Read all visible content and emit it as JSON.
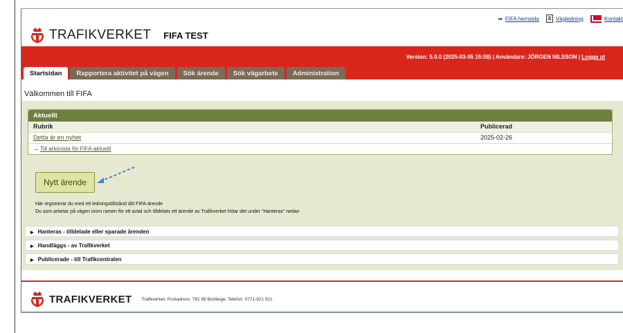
{
  "toplinks": {
    "fifa_home": "FIFA hemsida",
    "guide": "Vägledning",
    "contact": "Kontakt"
  },
  "brand": {
    "name": "TRAFIKVERKET",
    "app_title": "FIFA TEST",
    "color": "#d9261c"
  },
  "version_bar": {
    "version_text": "Version: 5.0.0 (2025-03-05 15:08) | Användare: JÖRGEN NILSSON | ",
    "logout": "Logga ut"
  },
  "tabs": [
    {
      "label": "Startsidan",
      "active": true
    },
    {
      "label": "Rapportera aktivitet på vägen",
      "active": false
    },
    {
      "label": "Sök ärende",
      "active": false
    },
    {
      "label": "Sök vägarbete",
      "active": false
    },
    {
      "label": "Administration",
      "active": false
    }
  ],
  "welcome": "Välkommen till FIFA",
  "news": {
    "title": "Aktuellt",
    "col_subject": "Rubrik",
    "col_published": "Publicerad",
    "rows": [
      {
        "subject": "Detta är en nyhet",
        "published": "2025-02-26"
      }
    ],
    "archive_link": "Till arkivsida för FIFA-aktuellt"
  },
  "new_case_button": "Nytt ärende",
  "hints": [
    "Här registrerar du med ett ledningstillstånd ditt FIFA-ärende",
    "Du som arbetar på vägen inom ramen för ett avtal och tilldelats ett ärende av Trafikverket hittar det under \"Hanteras\" nedan"
  ],
  "sections": [
    "Hanteras - tilldelade eller sparade ärenden",
    "Handläggs - av Trafikverket",
    "Publicerade - till Trafikcentralen"
  ],
  "footer": {
    "name": "TRAFIKVERKET",
    "address": "Trafikverket, Postadress: 781 89 Borlänge, Telefon: 0771-921 921"
  }
}
